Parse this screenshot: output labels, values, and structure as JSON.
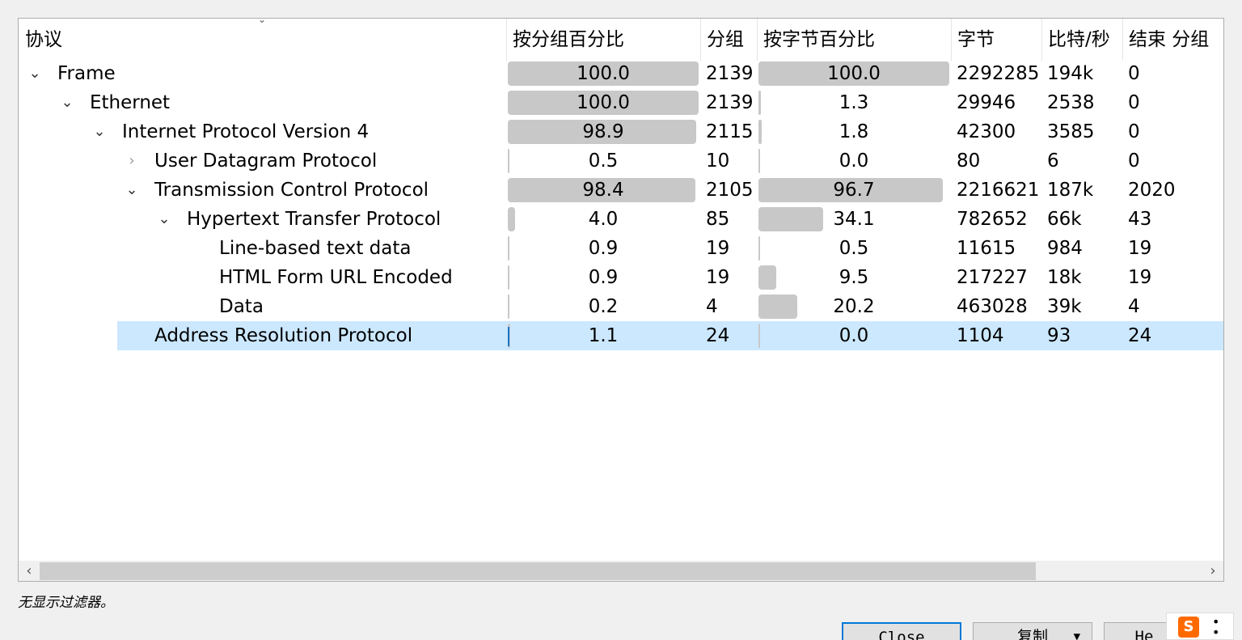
{
  "headers": {
    "protocol": "协议",
    "pct_packets": "按分组百分比",
    "packets": "分组",
    "pct_bytes": "按字节百分比",
    "bytes": "字节",
    "bits_per_sec": "比特/秒",
    "end_packets": "结束 分组"
  },
  "rows": [
    {
      "name": "Frame",
      "expand": "expanded",
      "pct_packets": "100.0",
      "pct_packets_value": 100.0,
      "packets": "2139",
      "pct_bytes": "100.0",
      "pct_bytes_value": 100.0,
      "bytes": "2292285",
      "bps": "194k",
      "end_packets": "0"
    },
    {
      "name": "Ethernet",
      "expand": "expanded",
      "pct_packets": "100.0",
      "pct_packets_value": 100.0,
      "packets": "2139",
      "pct_bytes": "1.3",
      "pct_bytes_value": 1.3,
      "bytes": "29946",
      "bps": "2538",
      "end_packets": "0"
    },
    {
      "name": "Internet Protocol Version 4",
      "expand": "expanded",
      "pct_packets": "98.9",
      "pct_packets_value": 98.9,
      "packets": "2115",
      "pct_bytes": "1.8",
      "pct_bytes_value": 1.8,
      "bytes": "42300",
      "bps": "3585",
      "end_packets": "0"
    },
    {
      "name": "User Datagram Protocol",
      "expand": "collapsed",
      "pct_packets": "0.5",
      "pct_packets_value": 0.5,
      "packets": "10",
      "pct_bytes": "0.0",
      "pct_bytes_value": 0.0,
      "bytes": "80",
      "bps": "6",
      "end_packets": "0"
    },
    {
      "name": "Transmission Control Protocol",
      "expand": "expanded",
      "pct_packets": "98.4",
      "pct_packets_value": 98.4,
      "packets": "2105",
      "pct_bytes": "96.7",
      "pct_bytes_value": 96.7,
      "bytes": "2216621",
      "bps": "187k",
      "end_packets": "2020"
    },
    {
      "name": "Hypertext Transfer Protocol",
      "expand": "expanded",
      "pct_packets": "4.0",
      "pct_packets_value": 4.0,
      "packets": "85",
      "pct_bytes": "34.1",
      "pct_bytes_value": 34.1,
      "bytes": "782652",
      "bps": "66k",
      "end_packets": "43"
    },
    {
      "name": "Line-based text data",
      "expand": "none",
      "pct_packets": "0.9",
      "pct_packets_value": 0.9,
      "packets": "19",
      "pct_bytes": "0.5",
      "pct_bytes_value": 0.5,
      "bytes": "11615",
      "bps": "984",
      "end_packets": "19"
    },
    {
      "name": "HTML Form URL Encoded",
      "expand": "none",
      "pct_packets": "0.9",
      "pct_packets_value": 0.9,
      "packets": "19",
      "pct_bytes": "9.5",
      "pct_bytes_value": 9.5,
      "bytes": "217227",
      "bps": "18k",
      "end_packets": "19"
    },
    {
      "name": "Data",
      "expand": "none",
      "pct_packets": "0.2",
      "pct_packets_value": 0.2,
      "packets": "4",
      "pct_bytes": "20.2",
      "pct_bytes_value": 20.2,
      "bytes": "463028",
      "bps": "39k",
      "end_packets": "4"
    },
    {
      "name": "Address Resolution Protocol",
      "expand": "none",
      "selected": true,
      "pct_packets": "1.1",
      "pct_packets_value": 1.1,
      "packets": "24",
      "pct_bytes": "0.0",
      "pct_bytes_value": 0.0,
      "bytes": "1104",
      "bps": "93",
      "end_packets": "24"
    }
  ],
  "status_text": "无显示过滤器。",
  "buttons": {
    "close": "Close",
    "copy": "复制",
    "help": "He"
  },
  "ime_logo": "S",
  "colors": {
    "bar": "#c8c8c8",
    "selection": "#cce8ff",
    "accent": "#0078d7"
  }
}
